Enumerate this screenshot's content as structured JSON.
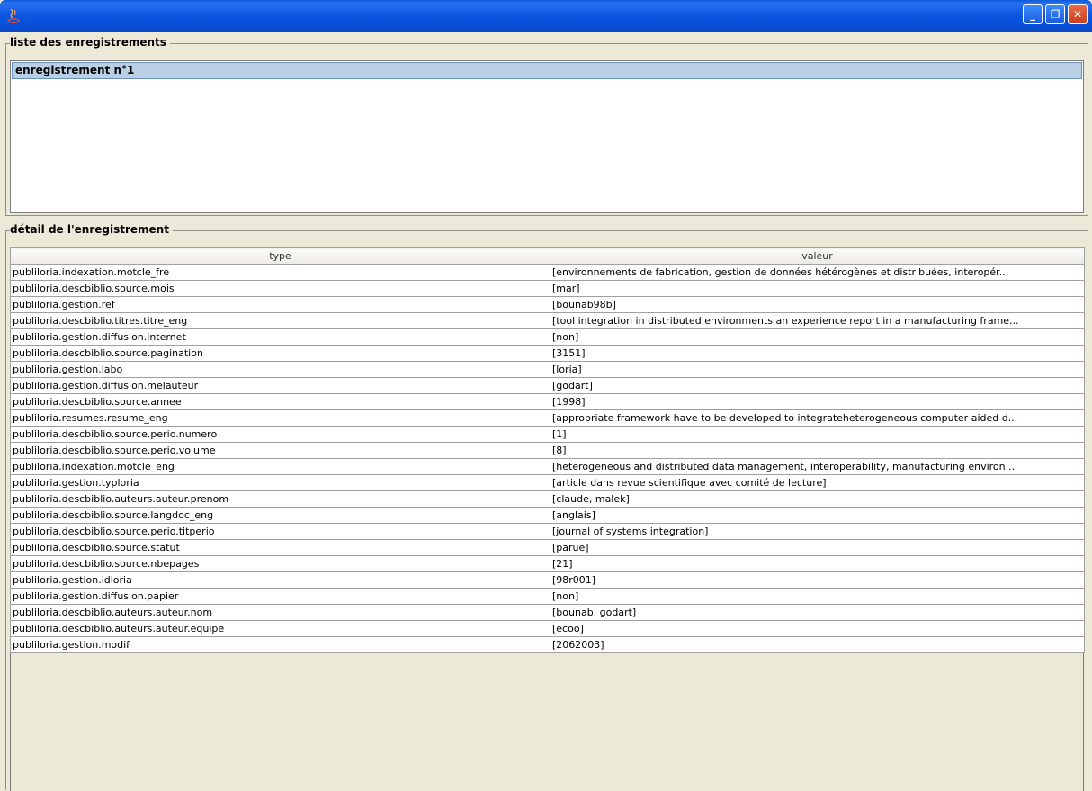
{
  "window": {
    "icon": "java-icon",
    "buttons": {
      "minimize": "_",
      "maximize": "❐",
      "close": "✕"
    },
    "colors": {
      "titlebar": "#0a55e0",
      "selection": "#b8cfe5"
    }
  },
  "records_panel": {
    "title": "liste des enregistrements",
    "items": [
      "enregistrement n°1"
    ]
  },
  "detail_panel": {
    "title": "détail de l'enregistrement",
    "columns": [
      "type",
      "valeur"
    ],
    "rows": [
      [
        "publiloria.indexation.motcle_fre",
        "[environnements de fabrication, gestion de données hétérogènes et distribuées, interopér..."
      ],
      [
        "publiloria.descbiblio.source.mois",
        "[mar]"
      ],
      [
        "publiloria.gestion.ref",
        "[bounab98b]"
      ],
      [
        "publiloria.descbiblio.titres.titre_eng",
        "[tool integration in distributed environments an experience report in a manufacturing frame..."
      ],
      [
        "publiloria.gestion.diffusion.internet",
        "[non]"
      ],
      [
        "publiloria.descbiblio.source.pagination",
        "[3151]"
      ],
      [
        "publiloria.gestion.labo",
        "[loria]"
      ],
      [
        "publiloria.gestion.diffusion.melauteur",
        "[godart]"
      ],
      [
        "publiloria.descbiblio.source.annee",
        "[1998]"
      ],
      [
        "publiloria.resumes.resume_eng",
        "[appropriate framework have to be developed to integrateheterogeneous computer aided d..."
      ],
      [
        "publiloria.descbiblio.source.perio.numero",
        "[1]"
      ],
      [
        "publiloria.descbiblio.source.perio.volume",
        "[8]"
      ],
      [
        "publiloria.indexation.motcle_eng",
        "[heterogeneous and distributed data management, interoperability, manufacturing environ..."
      ],
      [
        "publiloria.gestion.typloria",
        "[article dans revue scientifique avec comité de lecture]"
      ],
      [
        "publiloria.descbiblio.auteurs.auteur.prenom",
        "[claude, malek]"
      ],
      [
        "publiloria.descbiblio.source.langdoc_eng",
        "[anglais]"
      ],
      [
        "publiloria.descbiblio.source.perio.titperio",
        "[journal of systems integration]"
      ],
      [
        "publiloria.descbiblio.source.statut",
        "[parue]"
      ],
      [
        "publiloria.descbiblio.source.nbepages",
        "[21]"
      ],
      [
        "publiloria.gestion.idloria",
        "[98r001]"
      ],
      [
        "publiloria.gestion.diffusion.papier",
        "[non]"
      ],
      [
        "publiloria.descbiblio.auteurs.auteur.nom",
        "[bounab, godart]"
      ],
      [
        "publiloria.descbiblio.auteurs.auteur.equipe",
        "[ecoo]"
      ],
      [
        "publiloria.gestion.modif",
        "[2062003]"
      ]
    ]
  }
}
